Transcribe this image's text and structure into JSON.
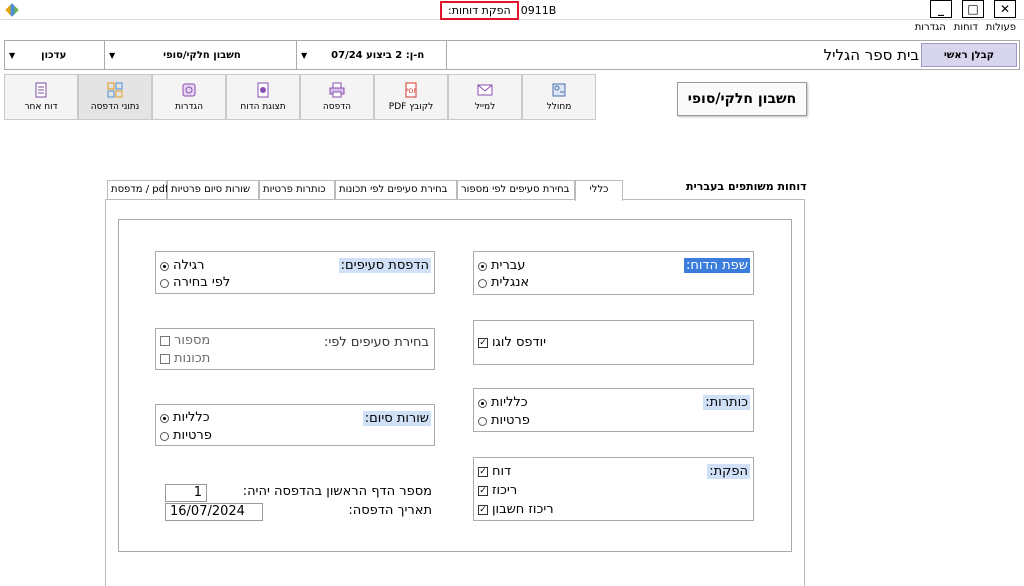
{
  "window": {
    "title_prefix": "0911B",
    "title_highlight": ":הפקת דוחות",
    "btn_minimize": "_",
    "btn_maximize": "□",
    "btn_close": "✕"
  },
  "menu": [
    "פעולות",
    "דוחות",
    "הגדרות"
  ],
  "infobar": {
    "contractor": "קבלן ראשי",
    "school": "בית ספר הגליל",
    "dropdown1": "ח-ן: 2 ביצוע 07/24",
    "dropdown2": "חשבון חלקי/סופי",
    "dropdown3": "עדכון"
  },
  "toolbar": [
    {
      "label": "מחולל",
      "icon": "generator-icon"
    },
    {
      "label": "למייל",
      "icon": "mail-icon"
    },
    {
      "label": "PDF לקובץ",
      "icon": "pdf-icon"
    },
    {
      "label": "הדפסה",
      "icon": "print-icon"
    },
    {
      "label": "תצוגת הדוח",
      "icon": "preview-icon"
    },
    {
      "label": "הגדרות",
      "icon": "settings-icon"
    },
    {
      "label": "נתוני הדפסה",
      "icon": "print-data-icon"
    },
    {
      "label": "דוח אחר",
      "icon": "other-report-icon"
    }
  ],
  "report_button": "חשבון חלקי/סופי",
  "section_title": "דוחות משותפים בעברית",
  "tabs": [
    "כללי",
    "בחירת סעיפים לפי מספור",
    "בחירת סעיפים לפי תכונות",
    "כותרות פרטיות",
    "שורות סיום פרטיות",
    "מדפסת / pdf"
  ],
  "groups": {
    "language": {
      "legend": "שפת הדוח:",
      "options": [
        "עברית",
        "אנגלית"
      ]
    },
    "logo": {
      "label": "יודפס לוגו"
    },
    "headers": {
      "legend": "כותרות:",
      "options": [
        "כלליות",
        "פרטיות"
      ]
    },
    "output": {
      "legend": "הפקת:",
      "options": [
        "דוח",
        "ריכוז",
        "ריכוז חשבון"
      ]
    },
    "print_sections": {
      "legend": "הדפסת סעיפים:",
      "options": [
        "רגילה",
        "לפי בחירה"
      ]
    },
    "select_by": {
      "legend": "בחירת סעיפים לפי:",
      "options": [
        "מספור",
        "תכונות"
      ]
    },
    "footer_rows": {
      "legend": "שורות סיום:",
      "options": [
        "כלליות",
        "פרטיות"
      ]
    },
    "print_fields": {
      "first_page_label": "מספר הדף הראשון בהדפסה יהיה:",
      "first_page_value": "1",
      "date_label": "תאריך הדפסה:",
      "date_value": "16/07/2024"
    }
  },
  "colors": {
    "highlight": "#3b7ddd",
    "legend_bg": "#cfe0f7",
    "title_border": "#e0152b",
    "contractor_bg": "#d7d6ee"
  }
}
